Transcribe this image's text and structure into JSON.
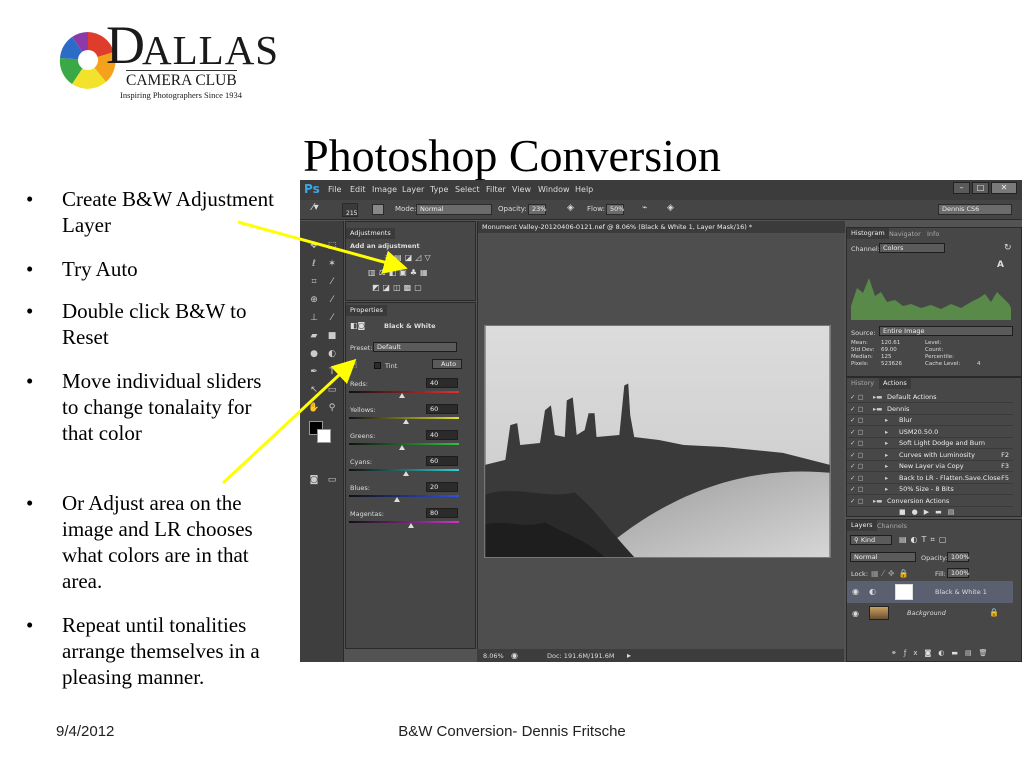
{
  "logo": {
    "brand_d": "D",
    "brand_rest": "ALLAS",
    "club": "CAMERA CLUB",
    "tagline": "Inspiring Photographers Since 1934"
  },
  "title": "Photoshop Conversion",
  "bullets": [
    {
      "marker": "•",
      "text": "Create B&W Adjustment Layer"
    },
    {
      "marker": "•",
      "text": "Try Auto"
    },
    {
      "marker": "•",
      "text": "Double click B&W to Reset"
    },
    {
      "marker": "•",
      "text": "Move individual sliders to change tonalaity for that color"
    },
    {
      "marker": "•",
      "text": "Or Adjust area on the image and LR chooses what colors are in that area."
    },
    {
      "marker": "•",
      "text": "Repeat until tonalities arrange themselves in a pleasing manner."
    }
  ],
  "footer": {
    "date": "9/4/2012",
    "center": "B&W Conversion- Dennis Fritsche"
  },
  "arrow_color": "#ffff00",
  "ps": {
    "logo": "Ps",
    "menu": [
      "File",
      "Edit",
      "Image",
      "Layer",
      "Type",
      "Select",
      "Filter",
      "View",
      "Window",
      "Help"
    ],
    "options": {
      "brush_size": "215",
      "mode_label": "Mode:",
      "mode": "Normal",
      "opacity_label": "Opacity:",
      "opacity": "23%",
      "flow_label": "Flow:",
      "flow": "50%",
      "workspace": "Dennis CS6"
    },
    "adjustments": {
      "tab": "Adjustments",
      "heading": "Add an adjustment"
    },
    "properties": {
      "tab": "Properties",
      "title": "Black & White",
      "preset_label": "Preset:",
      "preset": "Default",
      "tint": "Tint",
      "auto": "Auto",
      "sliders": [
        {
          "label": "Reds:",
          "value": "40",
          "color": "#e53030"
        },
        {
          "label": "Yellows:",
          "value": "60",
          "color": "#e5e030"
        },
        {
          "label": "Greens:",
          "value": "40",
          "color": "#30c040"
        },
        {
          "label": "Cyans:",
          "value": "60",
          "color": "#30d0d0"
        },
        {
          "label": "Blues:",
          "value": "20",
          "color": "#3050e5"
        },
        {
          "label": "Magentas:",
          "value": "80",
          "color": "#d030d0"
        }
      ]
    },
    "document": {
      "tab": "Monument Valley-20120406-0121.nef @ 8.06% (Black & White 1, Layer Mask/16) *",
      "zoom": "8.06%",
      "doc_size": "Doc: 191.6M/191.6M"
    },
    "histogram": {
      "tabs": [
        "Histogram",
        "Navigator",
        "Info"
      ],
      "channel_label": "Channel:",
      "channel": "Colors",
      "source_label": "Source:",
      "source": "Entire Image",
      "stats": [
        {
          "k": "Mean:",
          "v": "120.61"
        },
        {
          "k": "Std Dev:",
          "v": "69.00"
        },
        {
          "k": "Median:",
          "v": "125"
        },
        {
          "k": "Pixels:",
          "v": "523626"
        }
      ],
      "stats_right": [
        {
          "k": "Level:",
          "v": ""
        },
        {
          "k": "Count:",
          "v": ""
        },
        {
          "k": "Percentile:",
          "v": ""
        },
        {
          "k": "Cache Level:",
          "v": "4"
        }
      ]
    },
    "actions": {
      "tabs": [
        "History",
        "Actions"
      ],
      "rows": [
        {
          "name": "Default Actions",
          "key": ""
        },
        {
          "name": "Dennis",
          "key": ""
        },
        {
          "name": "Blur",
          "key": ""
        },
        {
          "name": "USM20.50.0",
          "key": ""
        },
        {
          "name": "Soft Light Dodge and Burn",
          "key": ""
        },
        {
          "name": "Curves with Luminosity",
          "key": "F2"
        },
        {
          "name": "New Layer via Copy",
          "key": "F3"
        },
        {
          "name": "Back to LR - Flatten.Save.Close",
          "key": "F5"
        },
        {
          "name": "50% Size - 8 Bits",
          "key": ""
        },
        {
          "name": "Conversion Actions",
          "key": ""
        }
      ]
    },
    "layers": {
      "tabs": [
        "Layers",
        "Channels"
      ],
      "kind": "Kind",
      "blend": "Normal",
      "opacity_label": "Opacity:",
      "opacity": "100%",
      "lock_label": "Lock:",
      "fill_label": "Fill:",
      "fill": "100%",
      "items": [
        {
          "name": "Black & White 1"
        },
        {
          "name": "Background"
        }
      ]
    }
  }
}
